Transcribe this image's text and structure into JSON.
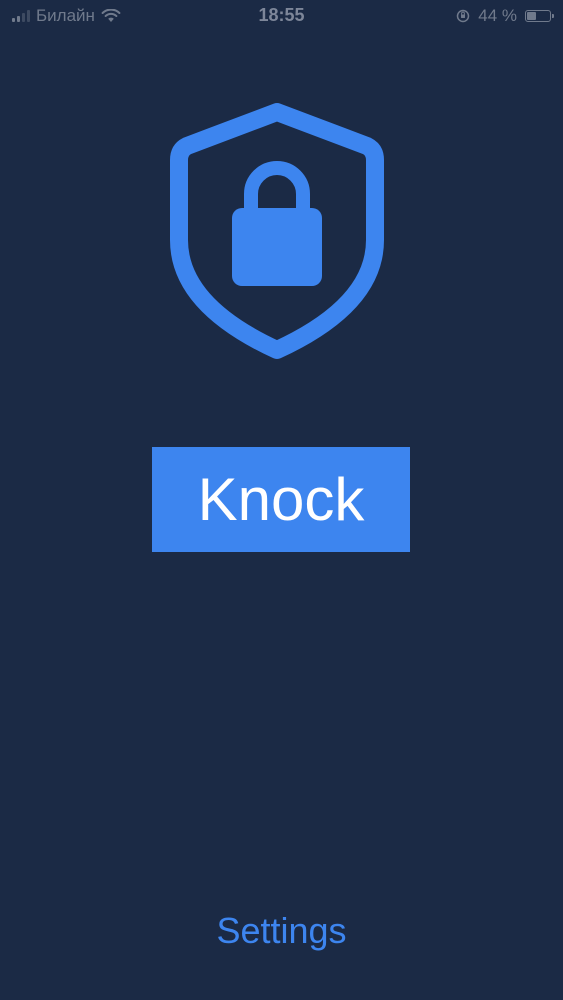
{
  "status_bar": {
    "carrier": "Билайн",
    "time": "18:55",
    "battery_percent_label": "44 %",
    "battery_level": 0.44,
    "signal_bars_active": 2,
    "signal_bars_total": 4
  },
  "main": {
    "knock_label": "Knock",
    "settings_label": "Settings"
  },
  "icons": {
    "shield": "shield-lock-icon",
    "wifi": "wifi-icon",
    "orientation_lock": "orientation-lock-icon",
    "battery": "battery-icon"
  },
  "colors": {
    "background": "#1b2a45",
    "accent": "#3d85ef",
    "button_text": "#ffffff",
    "status_text": "#707a8c"
  }
}
